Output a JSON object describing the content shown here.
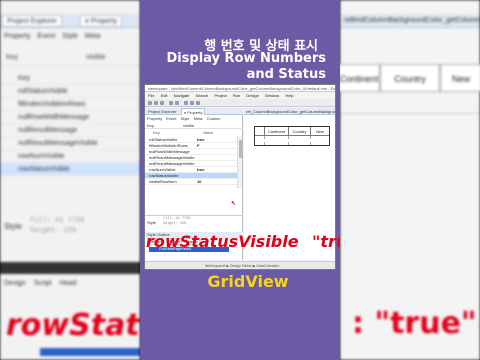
{
  "title": {
    "korean": "행 번호 및 상태 표시",
    "line1": "Display Row Numbers",
    "line2": "and Status"
  },
  "highlight": {
    "property": "rowStatusVisible",
    "equals": "=",
    "value": "\"true\""
  },
  "footer_label": "GridView",
  "colors": {
    "panel": "#6d5aa4",
    "title": "#ffffff",
    "highlight_red": "#e2001a",
    "footer": "#f7d51d",
    "selection": "#2a62c9"
  },
  "background": {
    "tabs": [
      "Project Explorer",
      "e Property"
    ],
    "menu": [
      "Property",
      "Event",
      "Style",
      "Meta"
    ],
    "key_label": "Key",
    "key_value": "visible",
    "props": [
      "Key",
      "rollStatusVisible",
      "fillIndexVisibleInRows",
      "nullRowWidthMessage",
      "nullResultMessage",
      "nullResultMessageVisible",
      "rowNumVisible",
      "rowStatusVisible"
    ],
    "style_label": "Style",
    "style_code": [
      "fill: #1 7756",
      "height: 25%"
    ],
    "bottom_tabs": [
      "Design",
      "Script",
      "Head"
    ],
    "big_left": "rowStatus",
    "big_right": ": \"true\"",
    "right_tab": "reBindColumnBackgroundColor_getColumnBack",
    "right_headers": [
      "Continent",
      "Country",
      "New"
    ]
  },
  "screenshot": {
    "window_title": "websquare - /ybt/WebContent/ColumnBackground/Color_getColumnBackgroundColor_UI/default.xml - Eclipse",
    "menu": [
      "File",
      "Edit",
      "Navigate",
      "Search",
      "Project",
      "Run",
      "Design",
      "Window",
      "Help"
    ],
    "left_tabs": [
      "Project Explorer",
      "e Property"
    ],
    "sub_tabs": [
      "Property",
      "Event",
      "Style",
      "Meta",
      "Custom"
    ],
    "key_label": "Key",
    "key_value": "visible",
    "head_key": "Key",
    "head_value": "Value",
    "rows": [
      {
        "key": "rollStatusVisible",
        "value": "true"
      },
      {
        "key": "fillIndexVisibleInRows",
        "value": "F"
      },
      {
        "key": "nullRowWidthMessage",
        "value": ""
      },
      {
        "key": "nullResultMessageVisible",
        "value": ""
      },
      {
        "key": "nullResultMessageVisible",
        "value": ""
      },
      {
        "key": "rowNumVisible",
        "value": "true"
      },
      {
        "key": "rowStatusVisible",
        "value": ""
      },
      {
        "key": "visibleRowNum",
        "value": "10"
      }
    ],
    "style_label": "Style",
    "style_code": [
      "fill: #1 7756",
      "height: 25%"
    ],
    "outline_tabs": "Style   Outline",
    "design_tabs": [
      "Design",
      "Script",
      "Head"
    ],
    "outline_selected": "GridViewPageHead1",
    "right_tab": "ref_ColumnBackgroundColor_getColumnBackgroundColor_UI",
    "grid_headers": [
      "",
      "Continent",
      "Country",
      "New"
    ],
    "statusbar": "WebSquare5 ▶ Design   Tables   ▶ DataCollection"
  }
}
